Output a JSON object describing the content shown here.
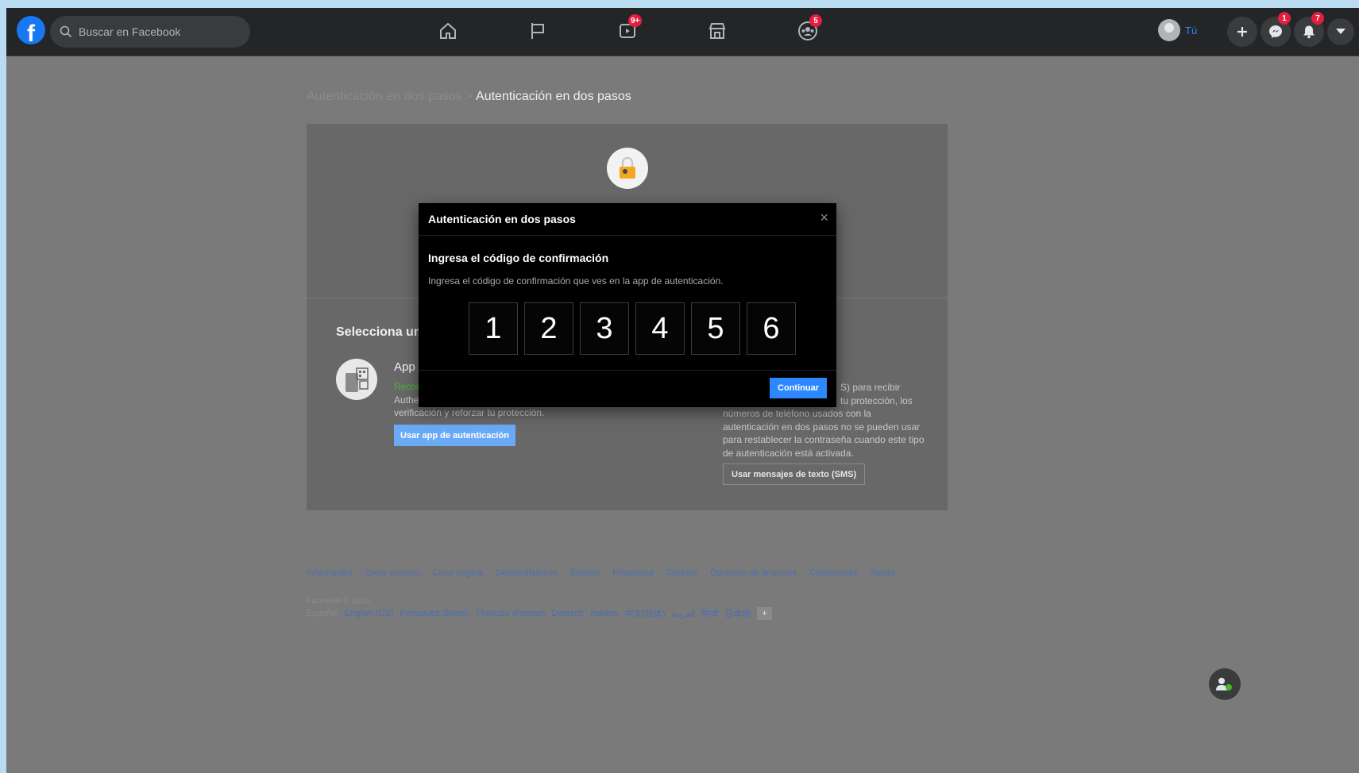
{
  "topbar": {
    "logo": "f",
    "search_placeholder": "Buscar en Facebook",
    "nav": [
      {
        "icon": "home-icon",
        "badge": ""
      },
      {
        "icon": "flag-icon",
        "badge": ""
      },
      {
        "icon": "watch-icon",
        "badge": "9+"
      },
      {
        "icon": "marketplace-icon",
        "badge": ""
      },
      {
        "icon": "groups-icon",
        "badge": "5"
      }
    ],
    "profile_name": "Tú",
    "messenger_badge": "1",
    "notifications_badge": "7"
  },
  "breadcrumb": {
    "parent": "Autenticación en dos pasos",
    "separator": ">",
    "current": "Autenticación en dos pasos"
  },
  "card": {
    "select_title": "Selecciona un",
    "app": {
      "title": "App",
      "recommended": "Recor",
      "desc_line1": "Authe",
      "desc_line2": "verificación y reforzar tu protección.",
      "button": "Usar app de autenticación"
    },
    "sms": {
      "heading_tail": ")",
      "line1": "S) para recibir",
      "line2": "tu protección, los",
      "line3": "números de teléfono usados con la",
      "line4": "autenticación en dos pasos no se pueden usar",
      "line5": "para restablecer la contraseña cuando este tipo",
      "line6": "de autenticación está activada.",
      "button": "Usar mensajes de texto (SMS)"
    }
  },
  "modal": {
    "title": "Autenticación en dos pasos",
    "close": "×",
    "subtitle": "Ingresa el código de confirmación",
    "hint": "Ingresa el código de confirmación que ves en la app de autenticación.",
    "code": [
      "1",
      "2",
      "3",
      "4",
      "5",
      "6"
    ],
    "continue": "Continuar"
  },
  "footer": {
    "links": [
      "Información",
      "Crear anuncio",
      "Crear página",
      "Desarrolladores",
      "Empleo",
      "Privacidad",
      "Cookies",
      "Opciones de anuncios",
      "Condiciones",
      "Ayuda"
    ],
    "copyright": "Facebook © 2020",
    "languages_current": "Español",
    "languages": [
      "English (US)",
      "Português (Brasil)",
      "Français (France)",
      "Deutsch",
      "Italiano",
      "中文(简体)",
      "العربية",
      "हिन्दी",
      "日本語"
    ],
    "more": "+"
  },
  "colors": {
    "accent": "#2d88ff",
    "badge": "#e41e3f",
    "topbar": "#242526",
    "overlay_bg": "#7a7a7a",
    "modal_bg": "#000000",
    "recommended": "#42b72a"
  }
}
